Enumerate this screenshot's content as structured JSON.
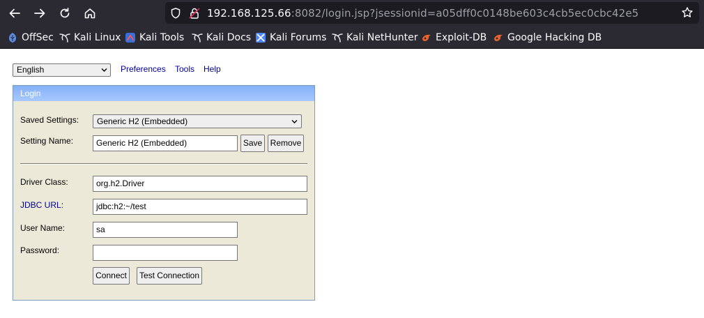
{
  "browser": {
    "url_host": "192.168.125.66",
    "url_rest": ":8082/login.jsp?jsessionid=a05dff0c0148be603c4cb5ec0cbc42e5",
    "bookmarks": [
      {
        "label": "OffSec",
        "icon": "offsec-icon"
      },
      {
        "label": "Kali Linux",
        "icon": "kali-dragon-icon"
      },
      {
        "label": "Kali Tools",
        "icon": "kali-tools-icon"
      },
      {
        "label": "Kali Docs",
        "icon": "kali-dragon-icon"
      },
      {
        "label": "Kali Forums",
        "icon": "kali-forums-icon"
      },
      {
        "label": "Kali NetHunter",
        "icon": "kali-dragon-icon"
      },
      {
        "label": "Exploit-DB",
        "icon": "exploit-db-icon"
      },
      {
        "label": "Google Hacking DB",
        "icon": "exploit-db-icon"
      }
    ]
  },
  "topbar": {
    "language": "English",
    "links": [
      "Preferences",
      "Tools",
      "Help"
    ]
  },
  "login": {
    "title": "Login",
    "saved_settings_label": "Saved Settings:",
    "saved_settings_value": "Generic H2 (Embedded)",
    "setting_name_label": "Setting Name:",
    "setting_name_value": "Generic H2 (Embedded)",
    "save_label": "Save",
    "remove_label": "Remove",
    "driver_class_label": "Driver Class:",
    "driver_class_value": "org.h2.Driver",
    "jdbc_url_label": "JDBC URL",
    "jdbc_url_colon": ":",
    "jdbc_url_value": "jdbc:h2:~/test",
    "user_name_label": "User Name:",
    "user_name_value": "sa",
    "password_label": "Password:",
    "password_value": "",
    "connect_label": "Connect",
    "test_connection_label": "Test Connection"
  },
  "colors": {
    "chrome_bg": "#2b2a33",
    "urlbar_bg": "#1c1b22",
    "panel_bg": "#ece9d8",
    "panel_header": "#93bbfb",
    "link": "#000099"
  }
}
